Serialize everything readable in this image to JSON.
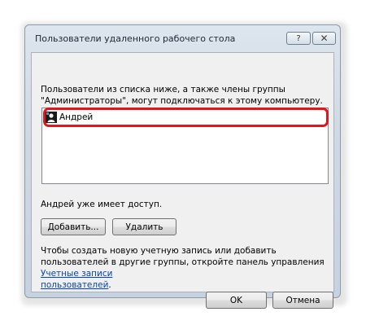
{
  "dialog": {
    "title": "Пользователи удаленного рабочего стола",
    "help_label": "?",
    "close_label": "✕"
  },
  "description": "Пользователи из списка ниже, а также члены группы \"Администраторы\", могут подключаться к этому компьютеру.",
  "users": [
    {
      "name": "Андрей",
      "icon": "user-icon"
    }
  ],
  "status": "Андрей уже имеет доступ.",
  "buttons": {
    "add": "Добавить...",
    "remove": "Удалить",
    "ok": "OK",
    "cancel": "Отмена"
  },
  "hint": {
    "text": "Чтобы создать новую учетную запись или добавить пользователей в другие группы, откройте панель управления ",
    "link_line1": "Учетные записи",
    "link_line2": "пользователей",
    "end": "."
  },
  "colors": {
    "highlight": "#e0161b",
    "link": "#0645ad"
  }
}
